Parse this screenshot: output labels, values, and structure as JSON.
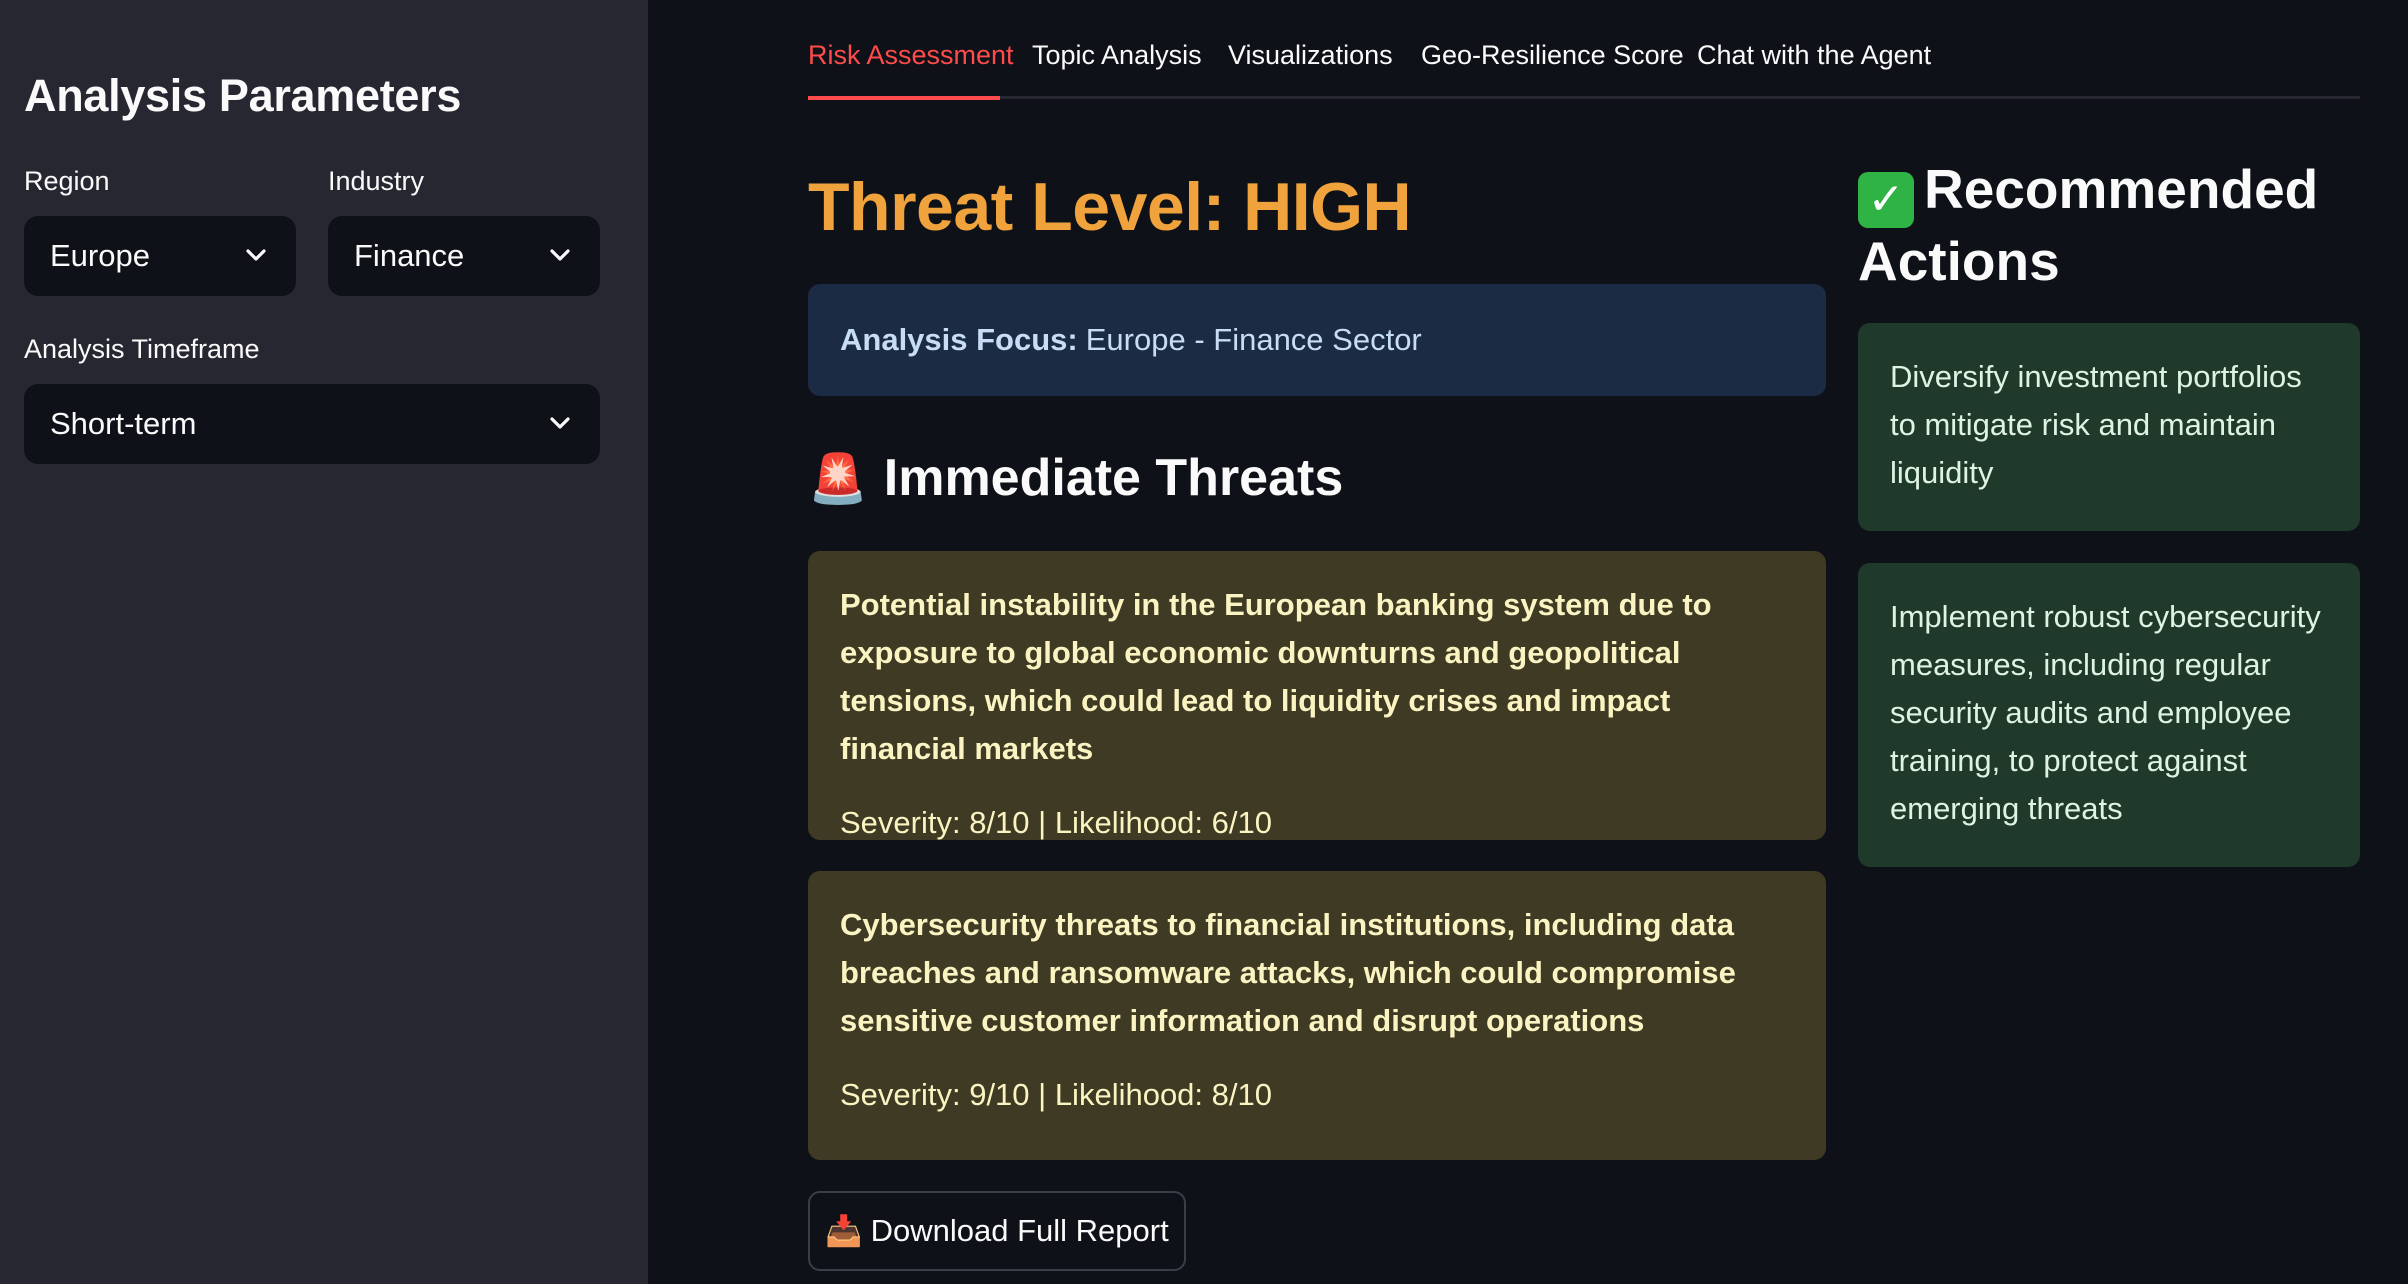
{
  "sidebar": {
    "title": "Analysis Parameters",
    "region": {
      "label": "Region",
      "value": "Europe"
    },
    "industry": {
      "label": "Industry",
      "value": "Finance"
    },
    "timeframe": {
      "label": "Analysis Timeframe",
      "value": "Short-term"
    }
  },
  "tabs": [
    {
      "label": "Risk Assessment",
      "active": true
    },
    {
      "label": "Topic Analysis",
      "active": false
    },
    {
      "label": "Visualizations",
      "active": false
    },
    {
      "label": "Geo-Resilience Score",
      "active": false
    },
    {
      "label": "Chat with the Agent",
      "active": false
    }
  ],
  "assessment": {
    "threat_level": "Threat Level: HIGH",
    "threat_level_color": "#f0a33c",
    "focus_label": "Analysis Focus:",
    "focus_value": "Europe - Finance Sector",
    "immediate_threats_emoji": "🚨",
    "immediate_threats_title": "Immediate Threats",
    "threats": [
      {
        "description": "Potential instability in the European banking system due to exposure to global economic downturns and geopolitical tensions, which could lead to liquidity crises and impact financial markets",
        "meta": "Severity: 8/10 | Likelihood: 6/10"
      },
      {
        "description": "Cybersecurity threats to financial institutions, including data breaches and ransomware attacks, which could compromise sensitive customer information and disrupt operations",
        "meta": "Severity: 9/10 | Likelihood: 8/10"
      }
    ],
    "download_emoji": "📥",
    "download_label": "Download Full Report"
  },
  "recommendations": {
    "emoji": "✓",
    "title": "Recommended Actions",
    "items": [
      {
        "text": "Diversify investment portfolios to mitigate risk and maintain liquidity"
      },
      {
        "text": "Implement robust cybersecurity measures, including regular security audits and employee training, to protect against emerging threats"
      }
    ]
  },
  "colors": {
    "accent": "#ff4b4b",
    "sidebar_bg": "#262730",
    "main_bg": "#0e1117",
    "info_bg": "#1c2b44",
    "warning_bg": "#3e3a23",
    "success_bg": "#1f3a2b"
  }
}
